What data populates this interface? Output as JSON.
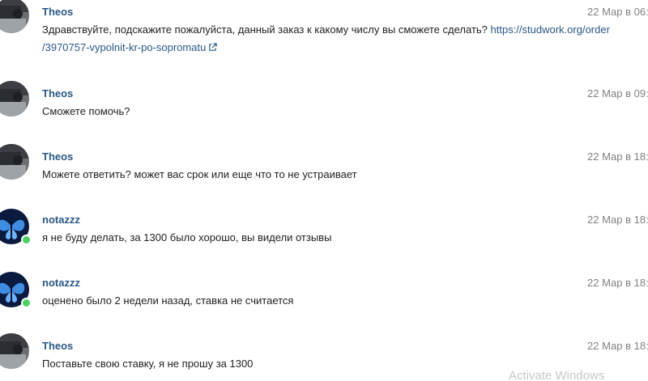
{
  "messages": [
    {
      "author": "Theos",
      "date": "22 Мар в 06:",
      "text": "Здравствуйте, подскажите пожалуйста, данный заказ к какому числу вы сможете сделать? ",
      "link_line1": "https://studwork.org/order",
      "link_line2": "/3970757-vypolnit-kr-po-sopromatu",
      "avatar_icon": "user-photo-avatar",
      "online": false
    },
    {
      "author": "Theos",
      "date": "22 Мар в 09:",
      "text": "Сможете помочь?",
      "avatar_icon": "user-photo-avatar",
      "online": false
    },
    {
      "author": "Theos",
      "date": "22 Мар в 18:",
      "text": "Можете ответить? может вас срок или еще что то не устраивает",
      "avatar_icon": "user-photo-avatar",
      "online": false
    },
    {
      "author": "notazzz",
      "date": "22 Мар в 18:",
      "text": "я не буду делать, за 1300 было хорошо, вы видели отзывы",
      "avatar_icon": "blue-butterfly-avatar",
      "online": true
    },
    {
      "author": "notazzz",
      "date": "22 Мар в 18:",
      "text": "оценено было 2 недели назад, ставка не считается",
      "avatar_icon": "blue-butterfly-avatar",
      "online": true
    },
    {
      "author": "Theos",
      "date": "22 Мар в 18:",
      "text": "Поставьте свою ставку, я не прошу за 1300",
      "avatar_icon": "user-photo-avatar",
      "online": false
    }
  ],
  "watermark": "Activate Windows",
  "colors": {
    "author": "#2a5885",
    "link": "#2a5885",
    "date": "#828282",
    "text": "#222222",
    "online": "#4bd163"
  }
}
